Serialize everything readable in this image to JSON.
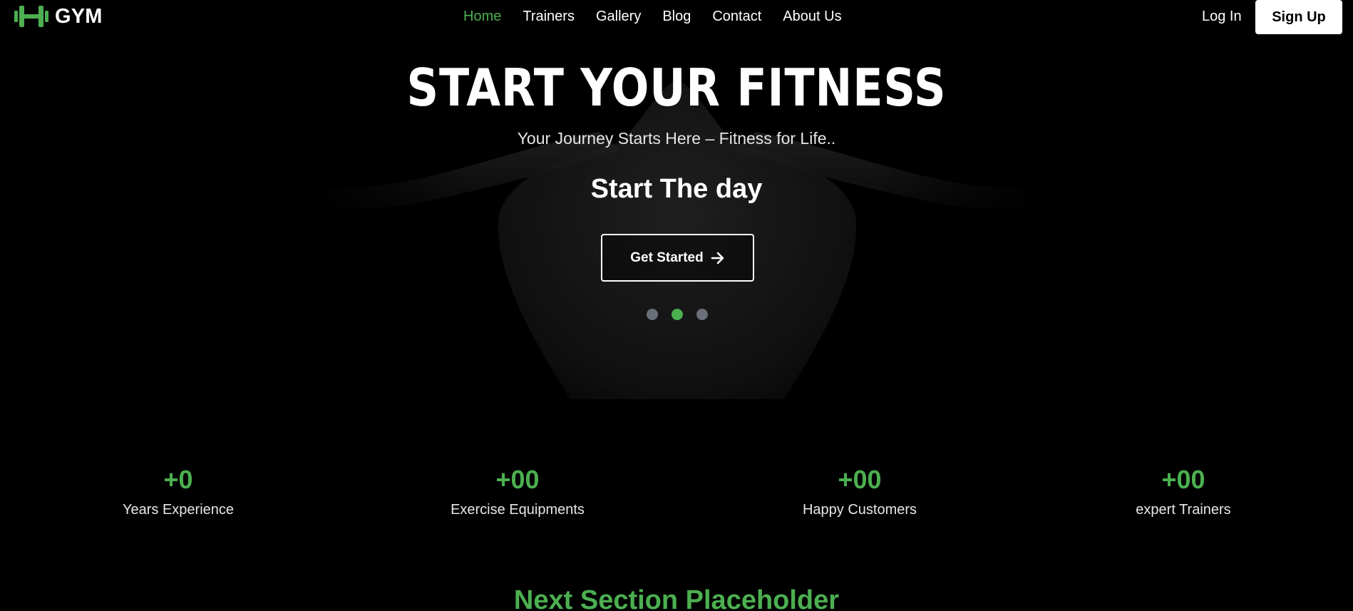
{
  "brand": {
    "name": "GYM",
    "accent": "#4caf50",
    "logo_icon": "dumbbell-icon"
  },
  "nav": {
    "items": [
      {
        "label": "Home",
        "active": true
      },
      {
        "label": "Trainers",
        "active": false
      },
      {
        "label": "Gallery",
        "active": false
      },
      {
        "label": "Blog",
        "active": false
      },
      {
        "label": "Contact",
        "active": false
      },
      {
        "label": "About Us",
        "active": false
      }
    ],
    "login_label": "Log In",
    "signup_label": "Sign Up"
  },
  "hero": {
    "title": "START YOUR FITNESS",
    "subtitle": "Your Journey Starts Here – Fitness for Life..",
    "tagline": "Start The day",
    "cta_label": "Get Started",
    "cta_icon": "arrow-right-icon",
    "slides_count": 3,
    "active_slide": 2
  },
  "stats": [
    {
      "value": "+0",
      "label": "Years Experience"
    },
    {
      "value": "+00",
      "label": "Exercise Equipments"
    },
    {
      "value": "+00",
      "label": "Happy Customers"
    },
    {
      "value": "+00",
      "label": "expert Trainers"
    }
  ],
  "next_section": {
    "title": "Next Section Placeholder"
  }
}
